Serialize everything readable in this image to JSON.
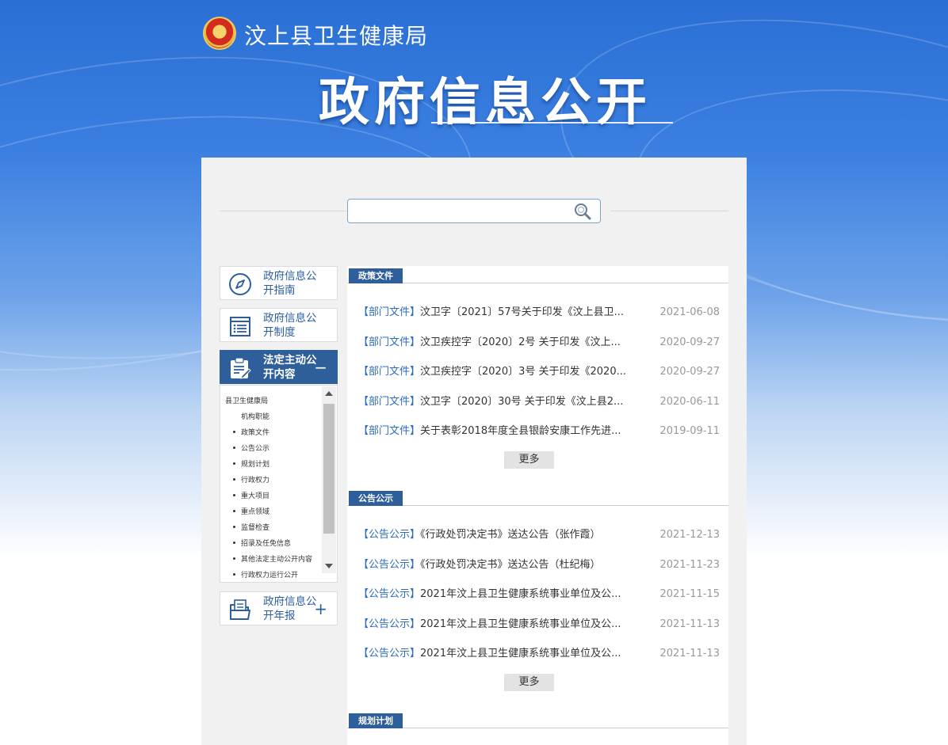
{
  "header": {
    "org_name": "汶上县卫生健康局",
    "title": "政府信息公开"
  },
  "search": {
    "placeholder": "",
    "value": ""
  },
  "sidebar": {
    "cards": [
      {
        "label": "政府信息公开指南",
        "icon": "compass-icon"
      },
      {
        "label": "政府信息公开制度",
        "icon": "document-list-icon"
      },
      {
        "label": "法定主动公开内容",
        "icon": "clipboard-edit-icon",
        "toggle": "−"
      },
      {
        "label": "政府信息公开年报",
        "icon": "folder-file-icon",
        "toggle": "+"
      }
    ],
    "tree": {
      "root": "县卫生健康局",
      "items": [
        "机构职能",
        "政策文件",
        "公告公示",
        "规划计划",
        "行政权力",
        "重大项目",
        "重点领域",
        "监督检查",
        "招录及任免信息",
        "其他法定主动公开内容",
        "行政权力运行公开"
      ]
    }
  },
  "sections": [
    {
      "title": "政策文件",
      "rows": [
        {
          "tag": "【部门文件】",
          "title": "汶卫字〔2021〕57号关于印发《汶上县卫...",
          "date": "2021-06-08"
        },
        {
          "tag": "【部门文件】",
          "title": "汶卫疾控字〔2020〕2号 关于印发《汶上...",
          "date": "2020-09-27"
        },
        {
          "tag": "【部门文件】",
          "title": "汶卫疾控字〔2020〕3号 关于印发《2020...",
          "date": "2020-09-27"
        },
        {
          "tag": "【部门文件】",
          "title": "汶卫字〔2020〕30号 关于印发《汶上县2...",
          "date": "2020-06-11"
        },
        {
          "tag": "【部门文件】",
          "title": "关于表彰2018年度全县银龄安康工作先进...",
          "date": "2019-09-11"
        }
      ],
      "more": "更多"
    },
    {
      "title": "公告公示",
      "rows": [
        {
          "tag": "【公告公示】",
          "title": "《行政处罚决定书》送达公告（张作霞）",
          "date": "2021-12-13"
        },
        {
          "tag": "【公告公示】",
          "title": "《行政处罚决定书》送达公告（杜纪梅）",
          "date": "2021-11-23"
        },
        {
          "tag": "【公告公示】",
          "title": "2021年汶上县卫生健康系统事业单位及公...",
          "date": "2021-11-15"
        },
        {
          "tag": "【公告公示】",
          "title": "2021年汶上县卫生健康系统事业单位及公...",
          "date": "2021-11-13"
        },
        {
          "tag": "【公告公示】",
          "title": "2021年汶上县卫生健康系统事业单位及公...",
          "date": "2021-11-13"
        }
      ],
      "more": "更多"
    },
    {
      "title": "规划计划",
      "rows": [],
      "more": ""
    }
  ],
  "colors": {
    "accent": "#2e5f9b",
    "link": "#2b6bc2",
    "date": "#999999"
  }
}
